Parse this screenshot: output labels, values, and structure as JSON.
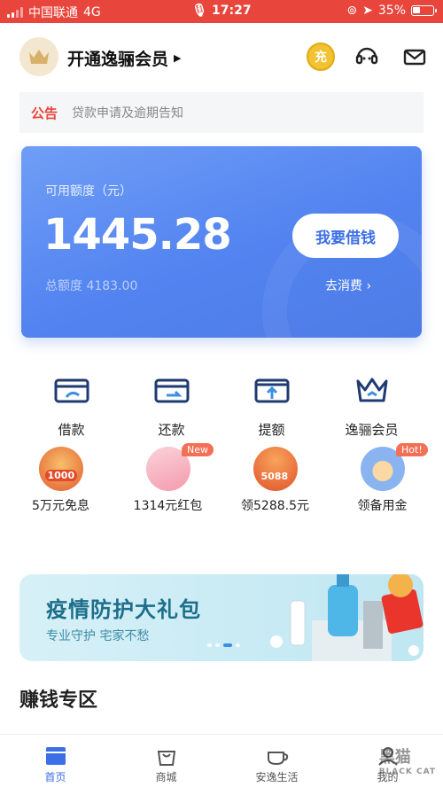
{
  "status_bar": {
    "carrier": "中国联通",
    "network": "4G",
    "time": "17:27",
    "battery": "35%"
  },
  "header": {
    "member_title": "开通逸骊会员",
    "coin_label": "充"
  },
  "notice": {
    "tag": "公告",
    "text": "贷款申请及逾期告知"
  },
  "credit_card": {
    "available_label": "可用额度（元）",
    "available_amount": "1445.28",
    "total_label": "总额度",
    "total_amount": "4183.00",
    "borrow_button": "我要借钱",
    "consume_link": "去消费 ›"
  },
  "quick_actions": [
    {
      "label": "借款",
      "icon": "wallet-icon"
    },
    {
      "label": "还款",
      "icon": "repay-card-icon"
    },
    {
      "label": "提额",
      "icon": "raise-limit-icon"
    },
    {
      "label": "逸骊会员",
      "icon": "crown-icon"
    }
  ],
  "promos": [
    {
      "label": "5万元免息",
      "badge_text": "1000",
      "tag": ""
    },
    {
      "label": "1314元红包",
      "badge_text": "",
      "tag": "New"
    },
    {
      "label": "领5288.5元",
      "badge_text": "5088",
      "tag": ""
    },
    {
      "label": "领备用金",
      "badge_text": "",
      "tag": "Hot!"
    }
  ],
  "banner": {
    "title": "疫情防护大礼包",
    "subtitle": "专业守护 宅家不愁",
    "slide_count": 4,
    "active_slide": 3
  },
  "section": {
    "title": "赚钱专区"
  },
  "tab_bar": [
    {
      "label": "首页",
      "icon": "home-icon",
      "active": true
    },
    {
      "label": "商城",
      "icon": "shopping-bag-icon",
      "active": false
    },
    {
      "label": "安逸生活",
      "icon": "coffee-cup-icon",
      "active": false
    },
    {
      "label": "我的",
      "icon": "profile-icon",
      "active": false
    }
  ],
  "watermark": {
    "text": "黑猫",
    "sub": "BLACK CAT"
  },
  "colors": {
    "brand_red": "#e8453c",
    "card_blue": "#5283f0",
    "accent_blue": "#3c6fe6"
  }
}
